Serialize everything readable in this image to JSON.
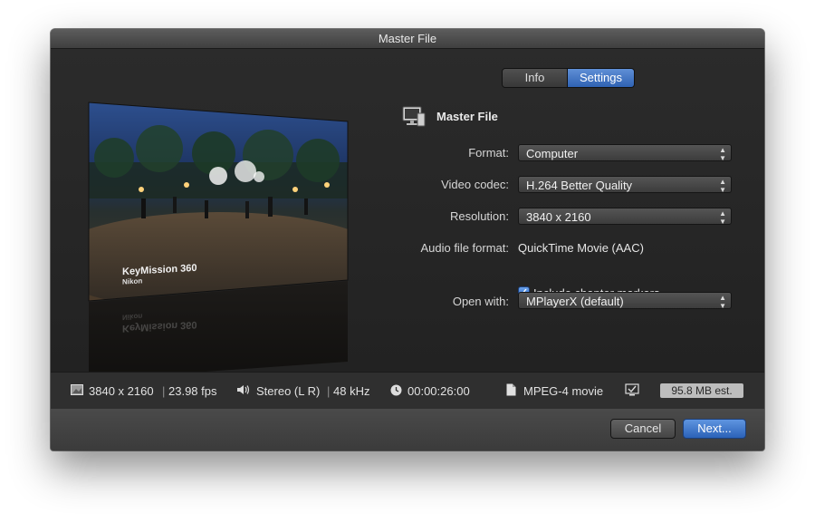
{
  "window": {
    "title": "Master File"
  },
  "tabs": [
    {
      "label": "Info",
      "selected": false
    },
    {
      "label": "Settings",
      "selected": true
    }
  ],
  "preview": {
    "brand_title": "KeyMission 360",
    "brand_sub": "Nikon"
  },
  "settings": {
    "heading": "Master File",
    "heading_icon": "computer-icon",
    "format": {
      "label": "Format:",
      "value": "Computer"
    },
    "video_codec": {
      "label": "Video codec:",
      "value": "H.264 Better Quality"
    },
    "resolution": {
      "label": "Resolution:",
      "value": "3840 x 2160"
    },
    "audio_file_format": {
      "label": "Audio file format:",
      "value": "QuickTime Movie (AAC)"
    },
    "chapter_markers": {
      "label": "Include chapter markers",
      "checked": true
    },
    "open_with": {
      "label": "Open with:",
      "value": "MPlayerX (default)"
    }
  },
  "info_bar": {
    "resolution": "3840 x 2160",
    "fps": "23.98 fps",
    "audio_channels": "Stereo (L R)",
    "sample_rate": "48 kHz",
    "duration": "00:00:26:00",
    "file_type": "MPEG-4 movie",
    "size_estimate": "95.8 MB est.",
    "separator": "|"
  },
  "footer": {
    "cancel_label": "Cancel",
    "next_label": "Next..."
  },
  "colors": {
    "accent": "#3a72c8",
    "background": "#262626",
    "text": "#e6e6e6"
  }
}
